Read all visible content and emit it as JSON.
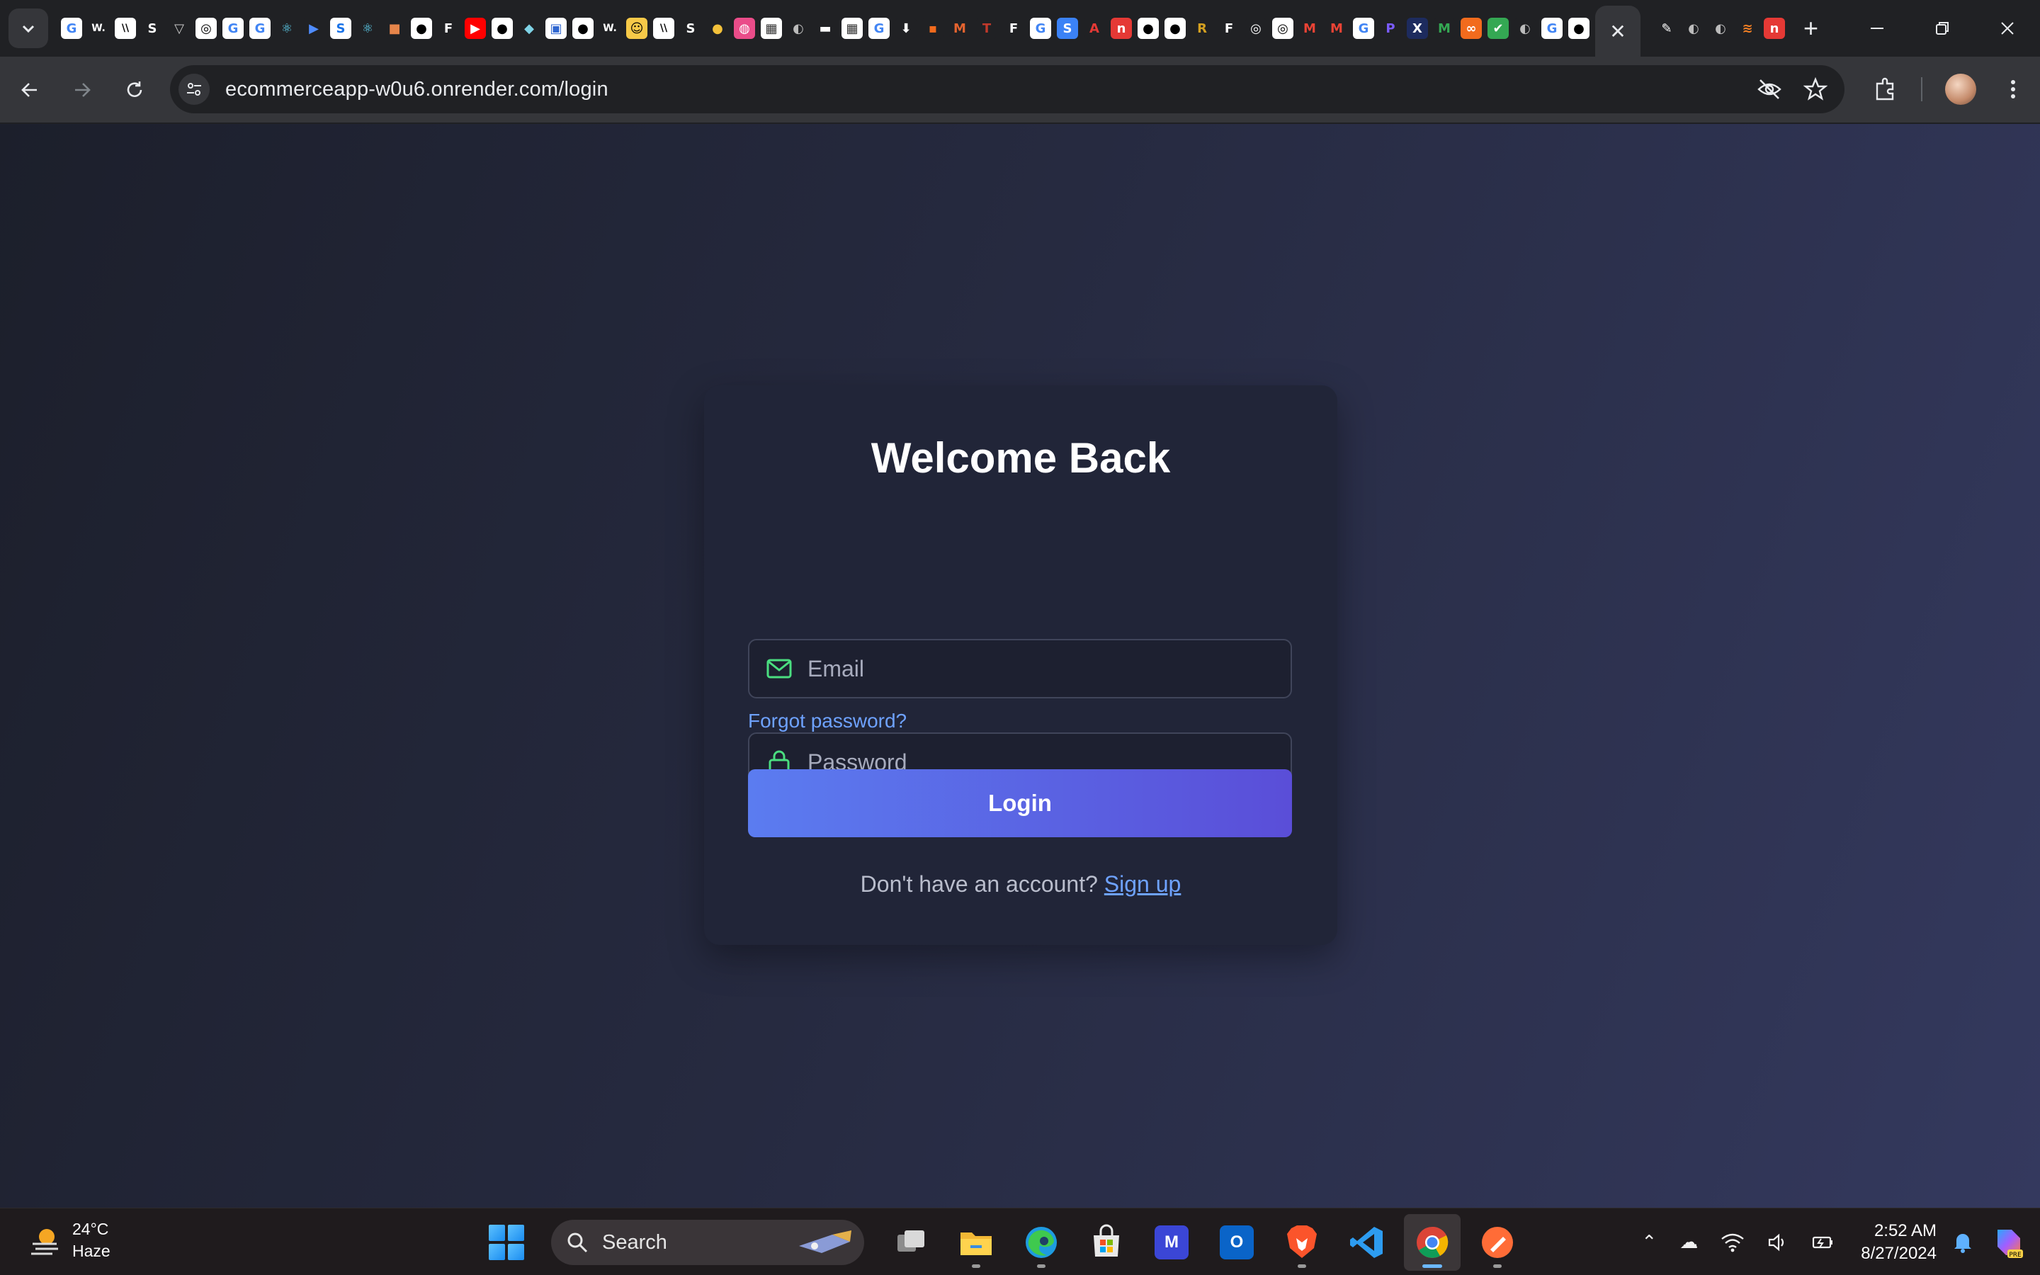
{
  "browser": {
    "tabs_search_icon": "chevron-down-icon",
    "favicons": [
      {
        "glyph": "G",
        "bg": "#ffffff",
        "fg": "#4285f4"
      },
      {
        "glyph": "W.",
        "bg": "#202124",
        "fg": "#ffffff"
      },
      {
        "glyph": "\\\\",
        "bg": "#ffffff",
        "fg": "#000000"
      },
      {
        "glyph": "S",
        "bg": "#202124",
        "fg": "#ffffff"
      },
      {
        "glyph": "▽",
        "bg": "#202124",
        "fg": "#cccccc"
      },
      {
        "glyph": "◎",
        "bg": "#ffffff",
        "fg": "#000000"
      },
      {
        "glyph": "G",
        "bg": "#ffffff",
        "fg": "#4285f4"
      },
      {
        "glyph": "G",
        "bg": "#ffffff",
        "fg": "#4285f4"
      },
      {
        "glyph": "⚛",
        "bg": "#202124",
        "fg": "#61dafb"
      },
      {
        "glyph": "▶",
        "bg": "#202124",
        "fg": "#4f8cff"
      },
      {
        "glyph": "S",
        "bg": "#ffffff",
        "fg": "#1a73e8"
      },
      {
        "glyph": "⚛",
        "bg": "#202124",
        "fg": "#61dafb"
      },
      {
        "glyph": "■",
        "bg": "#202124",
        "fg": "#e6854a"
      },
      {
        "glyph": "●",
        "bg": "#ffffff",
        "fg": "#000000"
      },
      {
        "glyph": "F",
        "bg": "#202124",
        "fg": "#ffffff"
      },
      {
        "glyph": "▶",
        "bg": "#ff0000",
        "fg": "#ffffff"
      },
      {
        "glyph": "●",
        "bg": "#ffffff",
        "fg": "#000000"
      },
      {
        "glyph": "◆",
        "bg": "#202124",
        "fg": "#7fd3e6"
      },
      {
        "glyph": "▣",
        "bg": "#ffffff",
        "fg": "#2f66d0"
      },
      {
        "glyph": "●",
        "bg": "#ffffff",
        "fg": "#000000"
      },
      {
        "glyph": "W.",
        "bg": "#202124",
        "fg": "#ffffff"
      },
      {
        "glyph": "☺",
        "bg": "#f7c948",
        "fg": "#000000"
      },
      {
        "glyph": "\\\\",
        "bg": "#ffffff",
        "fg": "#000000"
      },
      {
        "glyph": "S",
        "bg": "#202124",
        "fg": "#ffffff"
      },
      {
        "glyph": "●",
        "bg": "#202124",
        "fg": "#f3c13a"
      },
      {
        "glyph": "◍",
        "bg": "#ea4c89",
        "fg": "#ffffff"
      },
      {
        "glyph": "▦",
        "bg": "#ffffff",
        "fg": "#333333"
      },
      {
        "glyph": "◐",
        "bg": "#202124",
        "fg": "#bbbbbb"
      },
      {
        "glyph": "▬",
        "bg": "#202124",
        "fg": "#ffffff"
      },
      {
        "glyph": "▦",
        "bg": "#ffffff",
        "fg": "#333333"
      },
      {
        "glyph": "G",
        "bg": "#ffffff",
        "fg": "#4285f4"
      },
      {
        "glyph": "⬇",
        "bg": "#202124",
        "fg": "#ffffff"
      },
      {
        "glyph": "▪",
        "bg": "#202124",
        "fg": "#f26b1d"
      },
      {
        "glyph": "M",
        "bg": "#202124",
        "fg": "#e4632f"
      },
      {
        "glyph": "T",
        "bg": "#202124",
        "fg": "#c0392b"
      },
      {
        "glyph": "F",
        "bg": "#202124",
        "fg": "#ffffff"
      },
      {
        "glyph": "G",
        "bg": "#ffffff",
        "fg": "#4285f4"
      },
      {
        "glyph": "S",
        "bg": "#3b82f6",
        "fg": "#ffffff"
      },
      {
        "glyph": "A",
        "bg": "#202124",
        "fg": "#e53935"
      },
      {
        "glyph": "n",
        "bg": "#e53935",
        "fg": "#ffffff"
      },
      {
        "glyph": "●",
        "bg": "#ffffff",
        "fg": "#000000"
      },
      {
        "glyph": "●",
        "bg": "#ffffff",
        "fg": "#000000"
      },
      {
        "glyph": "R",
        "bg": "#202124",
        "fg": "#d4a020"
      },
      {
        "glyph": "F",
        "bg": "#202124",
        "fg": "#ffffff"
      },
      {
        "glyph": "◎",
        "bg": "#202124",
        "fg": "#ffffff"
      },
      {
        "glyph": "◎",
        "bg": "#ffffff",
        "fg": "#000000"
      },
      {
        "glyph": "M",
        "bg": "#202124",
        "fg": "#ea4335"
      },
      {
        "glyph": "M",
        "bg": "#202124",
        "fg": "#ea4335"
      },
      {
        "glyph": "G",
        "bg": "#ffffff",
        "fg": "#4285f4"
      },
      {
        "glyph": "P",
        "bg": "#202124",
        "fg": "#7b5cff"
      },
      {
        "glyph": "X",
        "bg": "#1d2b5e",
        "fg": "#ffffff"
      },
      {
        "glyph": "M",
        "bg": "#202124",
        "fg": "#34a853"
      },
      {
        "glyph": "∞",
        "bg": "#f26b1d",
        "fg": "#ffffff"
      },
      {
        "glyph": "✔",
        "bg": "#34a853",
        "fg": "#ffffff"
      },
      {
        "glyph": "◐",
        "bg": "#202124",
        "fg": "#bbbbbb"
      },
      {
        "glyph": "G",
        "bg": "#ffffff",
        "fg": "#4285f4"
      },
      {
        "glyph": "●",
        "bg": "#ffffff",
        "fg": "#000000"
      }
    ],
    "after_favicons": [
      {
        "glyph": "✎",
        "bg": "#202124",
        "fg": "#ffffff"
      },
      {
        "glyph": "◐",
        "bg": "#202124",
        "fg": "#bbbbbb"
      },
      {
        "glyph": "◐",
        "bg": "#202124",
        "fg": "#bbbbbb"
      },
      {
        "glyph": "≋",
        "bg": "#202124",
        "fg": "#f48024"
      },
      {
        "glyph": "n",
        "bg": "#e53935",
        "fg": "#ffffff"
      }
    ],
    "url": "ecommerceapp-w0u6.onrender.com/login"
  },
  "login": {
    "title": "Welcome Back",
    "email_placeholder": "Email",
    "password_placeholder": "Password",
    "forgot_password": "Forgot password?",
    "login_button": "Login",
    "no_account_text": "Don't have an account?",
    "signup_link": "Sign up",
    "accent_icon_color": "#4ade80",
    "link_color": "#6ea2ff"
  },
  "taskbar": {
    "weather_temp": "24°C",
    "weather_desc": "Haze",
    "search_label": "Search",
    "time": "2:52 AM",
    "date": "8/27/2024"
  }
}
